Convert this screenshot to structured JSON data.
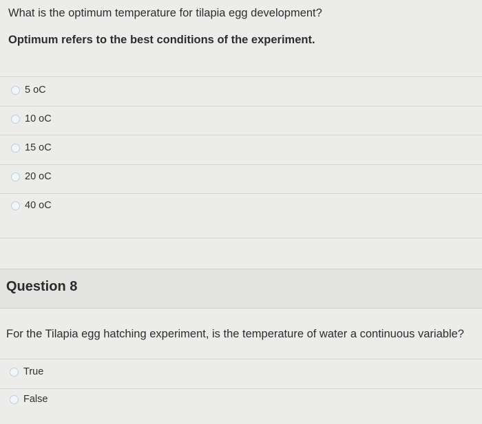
{
  "question7": {
    "prompt": "What is the optimum temperature for tilapia egg development?",
    "note": "Optimum refers to the best conditions of the experiment.",
    "options": [
      {
        "label": "5 oC"
      },
      {
        "label": "10 oC"
      },
      {
        "label": "15 oC"
      },
      {
        "label": "20 oC"
      },
      {
        "label": "40 oC"
      }
    ]
  },
  "question8": {
    "title": "Question 8",
    "prompt": "For the Tilapia egg hatching experiment, is the temperature of water a continuous variable?",
    "options": [
      {
        "label": "True"
      },
      {
        "label": "False"
      }
    ]
  },
  "colors": {
    "background": "#ececea",
    "radio_border": "#b9cfde",
    "header_background": "#e3e3e1"
  }
}
